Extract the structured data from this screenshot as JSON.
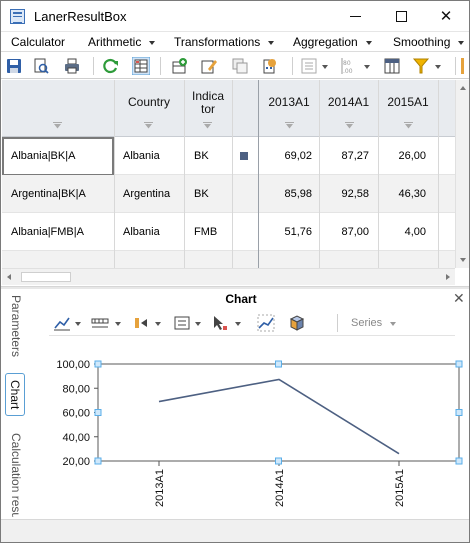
{
  "window": {
    "title": "LanerResultBox"
  },
  "menu": {
    "items": [
      {
        "label": "Calculator",
        "has_caret": false
      },
      {
        "label": "Arithmetic",
        "has_caret": true
      },
      {
        "label": "Transformations",
        "has_caret": true
      },
      {
        "label": "Aggregation",
        "has_caret": true
      },
      {
        "label": "Smoothing",
        "has_caret": true
      }
    ]
  },
  "toolbar": {
    "icons": [
      "save-icon",
      "print-preview-icon",
      "print-icon",
      "refresh-icon",
      "table-view-icon",
      "add-series-icon",
      "edit-icon",
      "copy-icon",
      "calculate-icon",
      "settings-icon",
      "decimal-places-icon",
      "columns-icon",
      "filter-icon"
    ],
    "decimal_label": "80\n.00"
  },
  "grid": {
    "headers": {
      "name": "",
      "country": "Country",
      "indicator": "Indica tor",
      "marker": "",
      "y2013": "2013A1",
      "y2014": "2014A1",
      "y2015": "2015A1"
    },
    "rows": [
      {
        "name": "Albania|BK|A",
        "country": "Albania",
        "indicator": "BK",
        "y2013": "69,02",
        "y2014": "87,27",
        "y2015": "26,00",
        "selected": true,
        "marker": true
      },
      {
        "name": "Argentina|BK|A",
        "country": "Argentina",
        "indicator": "BK",
        "y2013": "85,98",
        "y2014": "92,58",
        "y2015": "46,30",
        "selected": false,
        "marker": false
      },
      {
        "name": "Albania|FMB|A",
        "country": "Albania",
        "indicator": "FMB",
        "y2013": "51,76",
        "y2014": "87,00",
        "y2015": "4,00",
        "selected": false,
        "marker": false
      }
    ]
  },
  "side_tabs": {
    "parameters": "Parameters",
    "chart": "Chart",
    "calculation": "Calculation resu"
  },
  "chart_panel": {
    "title": "Chart",
    "series_label": "Series",
    "toolbar_icons": [
      "line-chart-icon",
      "axis-scale-icon",
      "series-order-icon",
      "legend-icon",
      "pointer-icon",
      "trend-icon",
      "3d-view-icon"
    ]
  },
  "chart_data": {
    "type": "line",
    "categories": [
      "2013A1",
      "2014A1",
      "2015A1"
    ],
    "series": [
      {
        "name": "",
        "values": [
          69.02,
          87.27,
          26.0
        ],
        "color": "#4d6082"
      }
    ],
    "ylim": [
      20,
      100
    ],
    "yticks": [
      "20,00",
      "40,00",
      "60,00",
      "80,00",
      "100,00"
    ],
    "ytick_values": [
      20,
      40,
      60,
      80,
      100
    ],
    "title": "",
    "xlabel": "",
    "ylabel": "",
    "grid": false,
    "selection_handles": true,
    "handle_color": "#5aaee8"
  }
}
